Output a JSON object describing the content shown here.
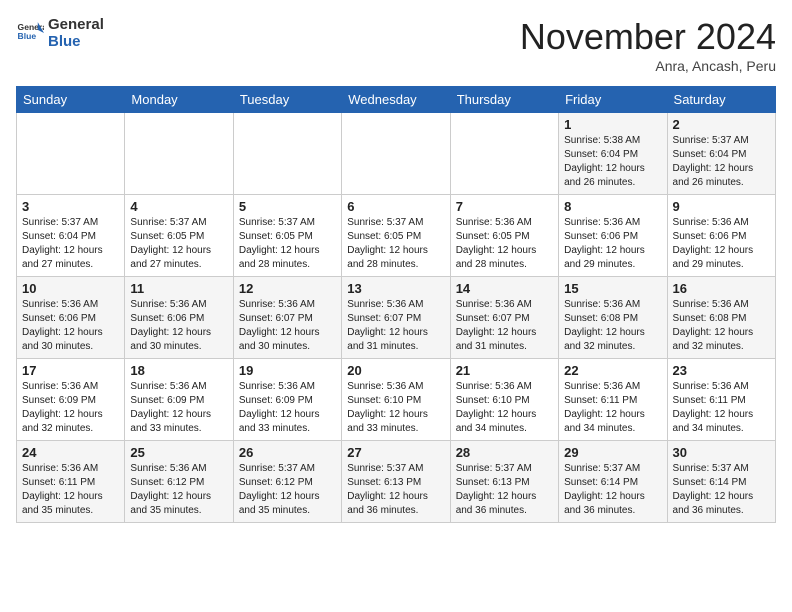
{
  "header": {
    "logo_general": "General",
    "logo_blue": "Blue",
    "month_title": "November 2024",
    "location": "Anra, Ancash, Peru"
  },
  "weekdays": [
    "Sunday",
    "Monday",
    "Tuesday",
    "Wednesday",
    "Thursday",
    "Friday",
    "Saturday"
  ],
  "weeks": [
    [
      {
        "day": "",
        "info": ""
      },
      {
        "day": "",
        "info": ""
      },
      {
        "day": "",
        "info": ""
      },
      {
        "day": "",
        "info": ""
      },
      {
        "day": "",
        "info": ""
      },
      {
        "day": "1",
        "info": "Sunrise: 5:38 AM\nSunset: 6:04 PM\nDaylight: 12 hours and 26 minutes."
      },
      {
        "day": "2",
        "info": "Sunrise: 5:37 AM\nSunset: 6:04 PM\nDaylight: 12 hours and 26 minutes."
      }
    ],
    [
      {
        "day": "3",
        "info": "Sunrise: 5:37 AM\nSunset: 6:04 PM\nDaylight: 12 hours and 27 minutes."
      },
      {
        "day": "4",
        "info": "Sunrise: 5:37 AM\nSunset: 6:05 PM\nDaylight: 12 hours and 27 minutes."
      },
      {
        "day": "5",
        "info": "Sunrise: 5:37 AM\nSunset: 6:05 PM\nDaylight: 12 hours and 28 minutes."
      },
      {
        "day": "6",
        "info": "Sunrise: 5:37 AM\nSunset: 6:05 PM\nDaylight: 12 hours and 28 minutes."
      },
      {
        "day": "7",
        "info": "Sunrise: 5:36 AM\nSunset: 6:05 PM\nDaylight: 12 hours and 28 minutes."
      },
      {
        "day": "8",
        "info": "Sunrise: 5:36 AM\nSunset: 6:06 PM\nDaylight: 12 hours and 29 minutes."
      },
      {
        "day": "9",
        "info": "Sunrise: 5:36 AM\nSunset: 6:06 PM\nDaylight: 12 hours and 29 minutes."
      }
    ],
    [
      {
        "day": "10",
        "info": "Sunrise: 5:36 AM\nSunset: 6:06 PM\nDaylight: 12 hours and 30 minutes."
      },
      {
        "day": "11",
        "info": "Sunrise: 5:36 AM\nSunset: 6:06 PM\nDaylight: 12 hours and 30 minutes."
      },
      {
        "day": "12",
        "info": "Sunrise: 5:36 AM\nSunset: 6:07 PM\nDaylight: 12 hours and 30 minutes."
      },
      {
        "day": "13",
        "info": "Sunrise: 5:36 AM\nSunset: 6:07 PM\nDaylight: 12 hours and 31 minutes."
      },
      {
        "day": "14",
        "info": "Sunrise: 5:36 AM\nSunset: 6:07 PM\nDaylight: 12 hours and 31 minutes."
      },
      {
        "day": "15",
        "info": "Sunrise: 5:36 AM\nSunset: 6:08 PM\nDaylight: 12 hours and 32 minutes."
      },
      {
        "day": "16",
        "info": "Sunrise: 5:36 AM\nSunset: 6:08 PM\nDaylight: 12 hours and 32 minutes."
      }
    ],
    [
      {
        "day": "17",
        "info": "Sunrise: 5:36 AM\nSunset: 6:09 PM\nDaylight: 12 hours and 32 minutes."
      },
      {
        "day": "18",
        "info": "Sunrise: 5:36 AM\nSunset: 6:09 PM\nDaylight: 12 hours and 33 minutes."
      },
      {
        "day": "19",
        "info": "Sunrise: 5:36 AM\nSunset: 6:09 PM\nDaylight: 12 hours and 33 minutes."
      },
      {
        "day": "20",
        "info": "Sunrise: 5:36 AM\nSunset: 6:10 PM\nDaylight: 12 hours and 33 minutes."
      },
      {
        "day": "21",
        "info": "Sunrise: 5:36 AM\nSunset: 6:10 PM\nDaylight: 12 hours and 34 minutes."
      },
      {
        "day": "22",
        "info": "Sunrise: 5:36 AM\nSunset: 6:11 PM\nDaylight: 12 hours and 34 minutes."
      },
      {
        "day": "23",
        "info": "Sunrise: 5:36 AM\nSunset: 6:11 PM\nDaylight: 12 hours and 34 minutes."
      }
    ],
    [
      {
        "day": "24",
        "info": "Sunrise: 5:36 AM\nSunset: 6:11 PM\nDaylight: 12 hours and 35 minutes."
      },
      {
        "day": "25",
        "info": "Sunrise: 5:36 AM\nSunset: 6:12 PM\nDaylight: 12 hours and 35 minutes."
      },
      {
        "day": "26",
        "info": "Sunrise: 5:37 AM\nSunset: 6:12 PM\nDaylight: 12 hours and 35 minutes."
      },
      {
        "day": "27",
        "info": "Sunrise: 5:37 AM\nSunset: 6:13 PM\nDaylight: 12 hours and 36 minutes."
      },
      {
        "day": "28",
        "info": "Sunrise: 5:37 AM\nSunset: 6:13 PM\nDaylight: 12 hours and 36 minutes."
      },
      {
        "day": "29",
        "info": "Sunrise: 5:37 AM\nSunset: 6:14 PM\nDaylight: 12 hours and 36 minutes."
      },
      {
        "day": "30",
        "info": "Sunrise: 5:37 AM\nSunset: 6:14 PM\nDaylight: 12 hours and 36 minutes."
      }
    ]
  ]
}
